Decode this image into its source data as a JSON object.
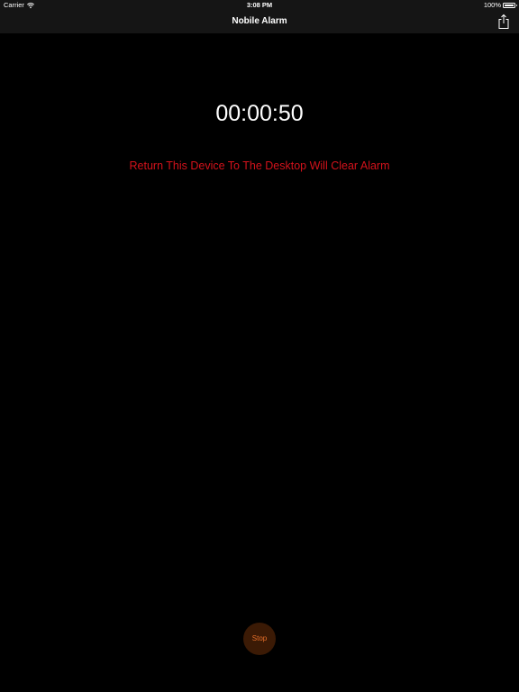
{
  "status_bar": {
    "carrier": "Carrier",
    "time": "3:08 PM",
    "battery": "100%"
  },
  "nav": {
    "title": "Nobile Alarm",
    "share_icon": "share-icon"
  },
  "main": {
    "timer": "00:00:50",
    "message": "Return This Device To The Desktop Will Clear Alarm",
    "stop_label": "Stop"
  },
  "colors": {
    "background": "#000000",
    "bar": "#151515",
    "message": "#d3121b",
    "stop_fill": "#3b1a05",
    "stop_text": "#e8702a"
  }
}
